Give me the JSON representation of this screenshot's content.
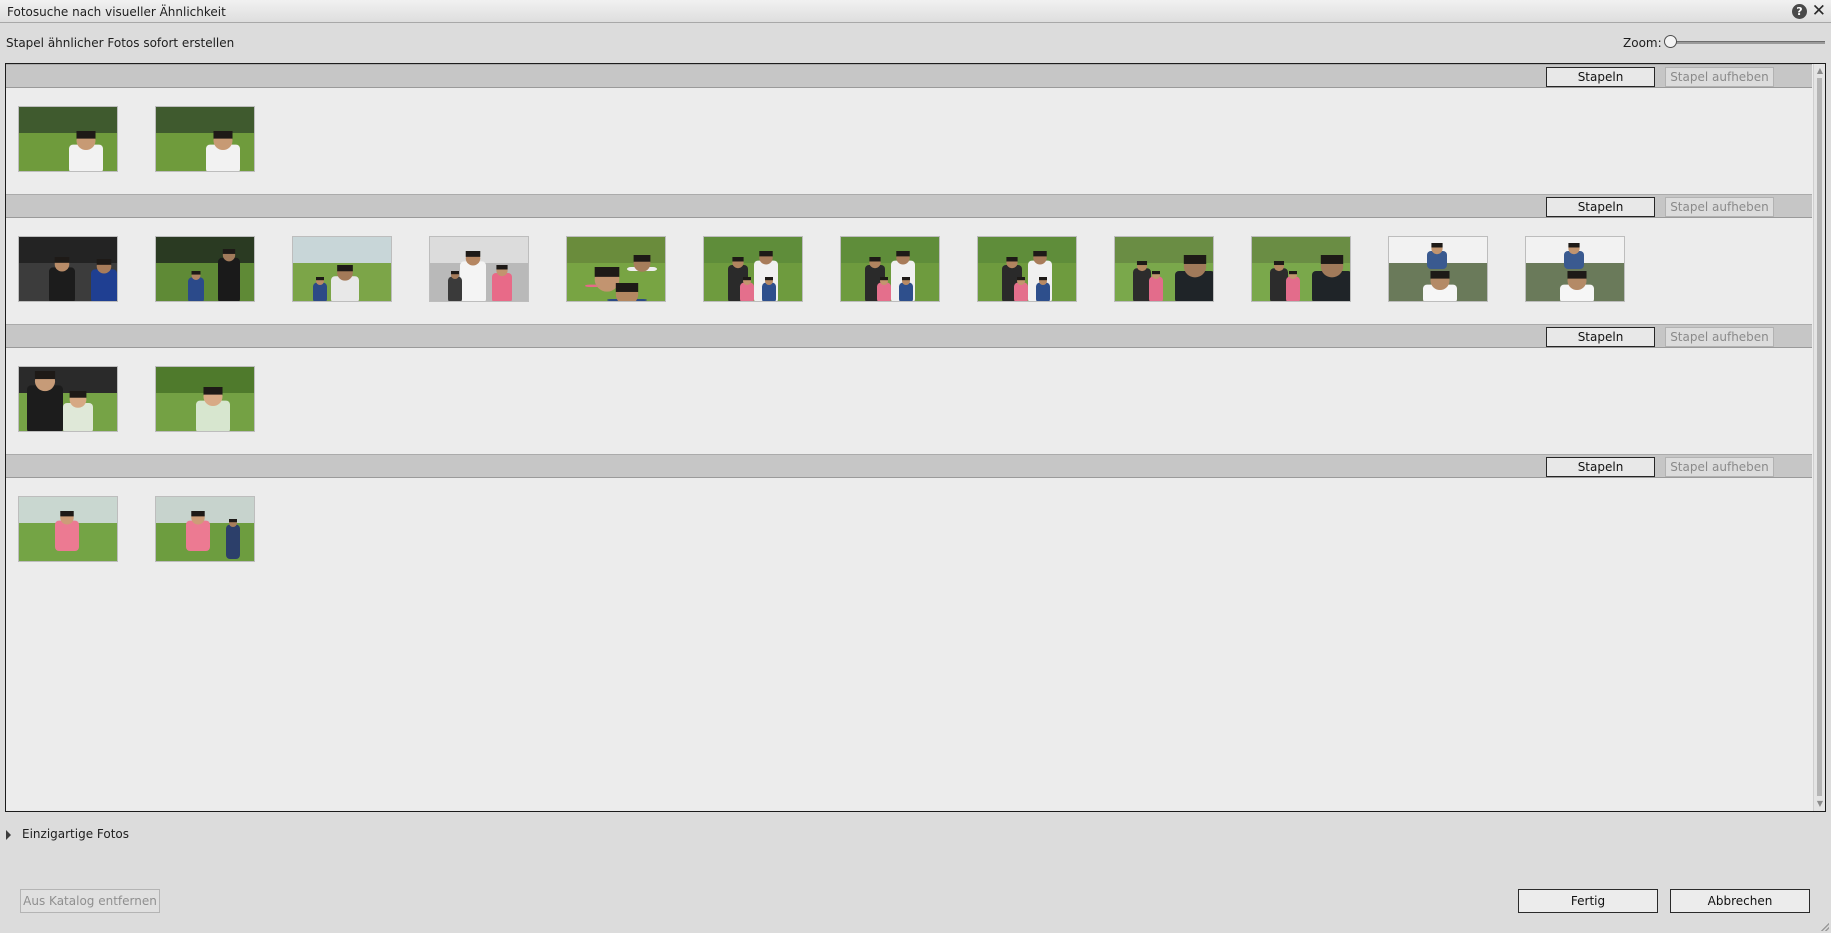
{
  "window": {
    "title": "Fotosuche nach visueller Ähnlichkeit",
    "help_icon": "help-icon",
    "close_icon": "close-icon"
  },
  "toolbar": {
    "subtitle": "Stapel ähnlicher Fotos sofort erstellen",
    "zoom_label": "Zoom:",
    "zoom_level": 0
  },
  "groups": [
    {
      "stack_label": "Stapeln",
      "unstack_label": "Stapel aufheben",
      "photos": [
        {
          "scene": "portrait-man-smiling"
        },
        {
          "scene": "portrait-man-smiling"
        }
      ]
    },
    {
      "stack_label": "Stapeln",
      "unstack_label": "Stapel aufheben",
      "photos": [
        {
          "scene": "man-football-child"
        },
        {
          "scene": "man-child-play"
        },
        {
          "scene": "kneeling-by-tree"
        },
        {
          "scene": "family-close"
        },
        {
          "scene": "family-lying-grass"
        },
        {
          "scene": "family-on-grass"
        },
        {
          "scene": "family-on-grass"
        },
        {
          "scene": "family-on-grass"
        },
        {
          "scene": "phone-photo-family"
        },
        {
          "scene": "phone-photo-family"
        },
        {
          "scene": "man-child-shoulders"
        },
        {
          "scene": "man-child-shoulders"
        }
      ]
    },
    {
      "stack_label": "Stapeln",
      "unstack_label": "Stapel aufheben",
      "photos": [
        {
          "scene": "girl-hug"
        },
        {
          "scene": "girl-blanket"
        }
      ]
    },
    {
      "stack_label": "Stapeln",
      "unstack_label": "Stapel aufheben",
      "photos": [
        {
          "scene": "girl-running"
        },
        {
          "scene": "girl-running-man"
        }
      ]
    }
  ],
  "unique_section": {
    "label": "Einzigartige Fotos",
    "expanded": false
  },
  "footer": {
    "remove_label": "Aus Katalog entfernen",
    "done_label": "Fertig",
    "cancel_label": "Abbrechen"
  }
}
